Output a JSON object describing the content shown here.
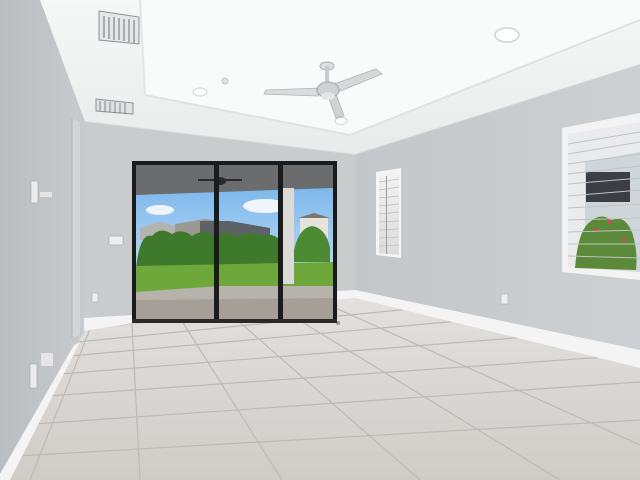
{
  "scene": {
    "description_colors": {
      "ceiling": "#f3f4f4",
      "tray_ceiling": "#f8f9f9",
      "wall_left": "#c3c6c8",
      "wall_back": "#c8cbcd",
      "wall_right": "#c6c9cb",
      "floor": "#d6d3cf",
      "floor_grout": "#b9b6b2",
      "baseboard": "#f4f4f4",
      "door_frame": "#1b1b1b",
      "sky": "#8fc3f0",
      "lawn": "#6fa83a",
      "hedge": "#3f7a2c",
      "patio": "#b7b2ac"
    },
    "fixtures": [
      {
        "name": "ceiling-fan-icon"
      },
      {
        "name": "recessed-light-icon"
      },
      {
        "name": "air-vent-icon"
      },
      {
        "name": "sliding-glass-door"
      },
      {
        "name": "window-blinds"
      },
      {
        "name": "wall-outlet-icon"
      },
      {
        "name": "light-switch-icon"
      }
    ]
  }
}
